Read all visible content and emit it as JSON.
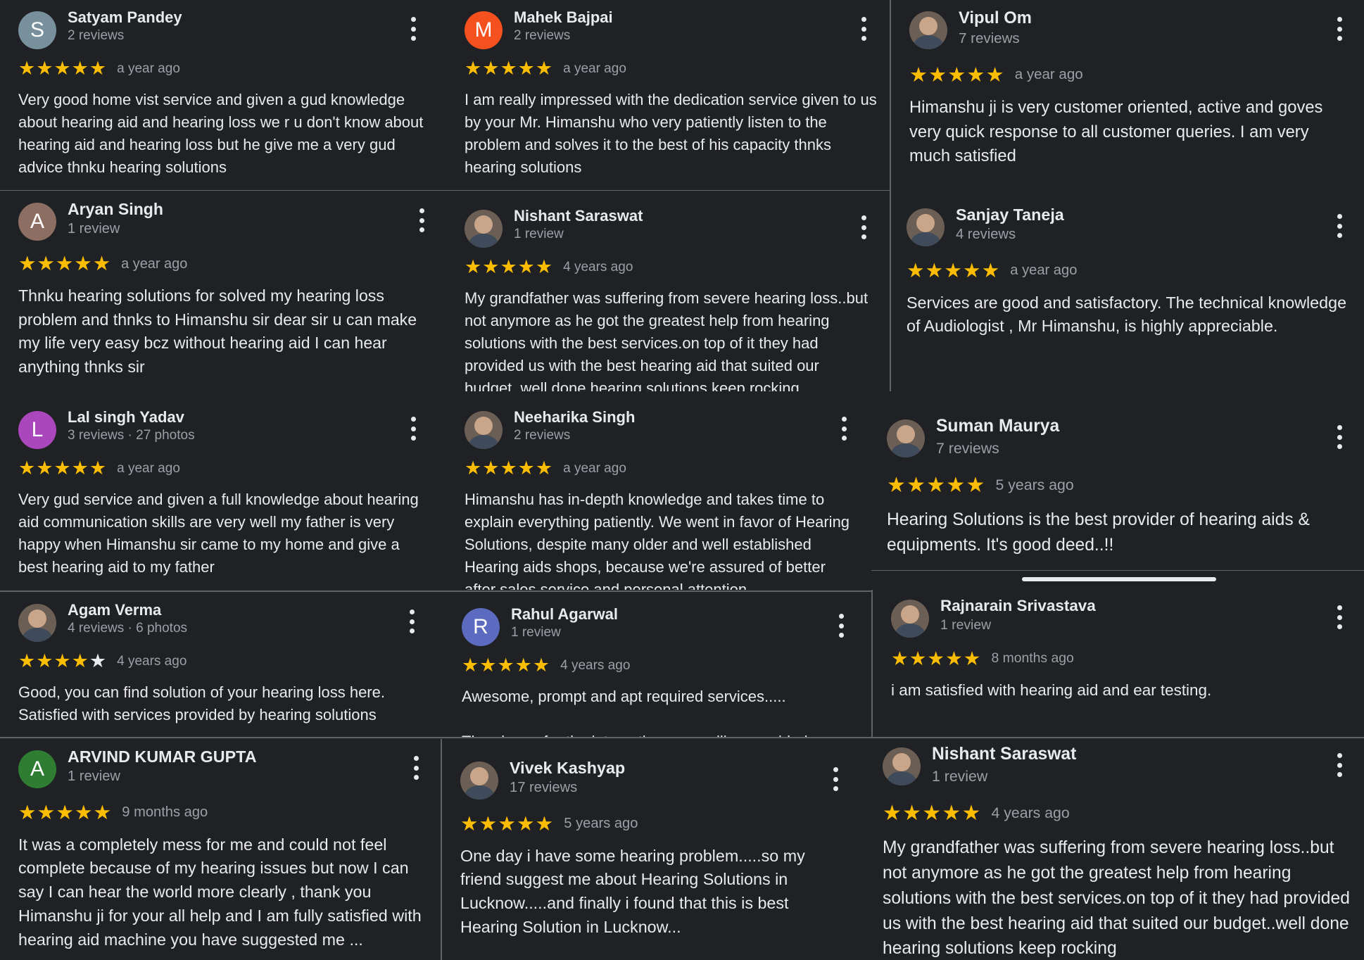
{
  "reviews": [
    {
      "name": "Satyam Pandey",
      "initial": "S",
      "avatar_color": "#78909c",
      "meta": "2 reviews",
      "stars": 5,
      "when": "a year ago",
      "text": "Very good home vist service and given a gud knowledge about hearing aid and hearing loss we r u don't know about hearing aid and hearing loss but he give me a very gud advice thnku hearing solutions"
    },
    {
      "name": "Mahek Bajpai",
      "initial": "M",
      "avatar_color": "#f4511e",
      "meta": "2 reviews",
      "stars": 5,
      "when": "a year ago",
      "text": "I am really impressed with the dedication service given to us by your Mr. Himanshu who very patiently listen to the problem and solves it to the best of his capacity thnks hearing solutions"
    },
    {
      "name": "Vipul Om",
      "initial": "",
      "avatar_color": "",
      "meta": "7 reviews",
      "stars": 5,
      "when": "a year ago",
      "text": "Himanshu ji is very customer oriented, active and goves very quick response to all customer queries. I am very much satisfied"
    },
    {
      "name": "Aryan Singh",
      "initial": "A",
      "avatar_color": "#8d6e63",
      "meta": "1 review",
      "stars": 5,
      "when": "a year ago",
      "text": "Thnku hearing solutions for solved my hearing loss problem and thnks to Himanshu sir dear sir u can make my life very easy bcz without hearing aid I can hear anything thnks sir"
    },
    {
      "name": "Nishant Saraswat",
      "initial": "",
      "avatar_color": "",
      "meta": "1 review",
      "stars": 5,
      "when": "4 years ago",
      "text": "My grandfather was suffering from severe hearing loss..but not anymore as he got the greatest help from hearing solutions with the best services.on top of it they had provided us with the best hearing aid that suited our budget..well done hearing solutions keep rocking"
    },
    {
      "name": "Sanjay Taneja",
      "initial": "",
      "avatar_color": "",
      "meta": "4 reviews",
      "stars": 5,
      "when": "a year ago",
      "text": "Services are good and satisfactory. The technical knowledge of Audiologist , Mr Himanshu, is highly appreciable."
    },
    {
      "name": "Lal singh Yadav",
      "initial": "L",
      "avatar_color": "#ab47bc",
      "meta": "3 reviews · 27 photos",
      "stars": 5,
      "when": "a year ago",
      "text": "Very gud service and given a full knowledge about hearing aid communication skills are very well my father is very happy when Himanshu sir came to my home and give a best hearing aid to my father"
    },
    {
      "name": "Neeharika Singh",
      "initial": "",
      "avatar_color": "",
      "meta": "2 reviews",
      "stars": 5,
      "when": "a year ago",
      "text": "Himanshu has in-depth knowledge and takes time to explain everything patiently. We went in favor of Hearing Solutions, despite many older and well established Hearing aids shops, because we're assured of better after sales service and personal attention."
    },
    {
      "name": "Suman Maurya",
      "initial": "",
      "avatar_color": "",
      "meta": "7 reviews",
      "stars": 5,
      "when": "5 years ago",
      "text": "Hearing Solutions is the best provider of hearing aids & equipments. It's good deed..!!"
    },
    {
      "name": "Agam Verma",
      "initial": "",
      "avatar_color": "",
      "meta": "4 reviews · 6 photos",
      "stars": 4,
      "when": "4 years ago",
      "text": "Good, you can find solution of your hearing loss here. Satisfied with services provided by hearing solutions"
    },
    {
      "name": "Rahul Agarwal",
      "initial": "R",
      "avatar_color": "#5c6bc0",
      "meta": "1 review",
      "stars": 5,
      "when": "4 years ago",
      "text": "Awesome, prompt and apt required services.....\n\nThumbs up for the interactive counselling provided."
    },
    {
      "name": "Rajnarain Srivastava",
      "initial": "",
      "avatar_color": "",
      "meta": "1 review",
      "stars": 5,
      "when": "8 months ago",
      "text": "i am satisfied with hearing aid and ear testing."
    },
    {
      "name": "ARVIND KUMAR GUPTA",
      "initial": "A",
      "avatar_color": "#2e7d32",
      "meta": "1 review",
      "stars": 5,
      "when": "9 months ago",
      "text": "It was a completely mess for me and could not feel complete because of my hearing issues but now I can say I can hear the world more clearly , thank you Himanshu ji for your all help and I am fully satisfied with hearing aid machine you have suggested me ..."
    },
    {
      "name": "Vivek Kashyap",
      "initial": "",
      "avatar_color": "",
      "meta": "17 reviews",
      "stars": 5,
      "when": "5 years ago",
      "text": "One day i have some hearing problem.....so my friend suggest me about Hearing Solutions in Lucknow.....and finally i found that this is best Hearing Solution in Lucknow..."
    },
    {
      "name": "Nishant Saraswat",
      "initial": "",
      "avatar_color": "",
      "meta": "1 review",
      "stars": 5,
      "when": "4 years ago",
      "text": "My grandfather was suffering from severe hearing loss..but not anymore as he got the greatest help from hearing solutions with the best services.on top of it they had provided us with the best hearing aid that suited our budget..well done hearing solutions keep rocking"
    }
  ]
}
